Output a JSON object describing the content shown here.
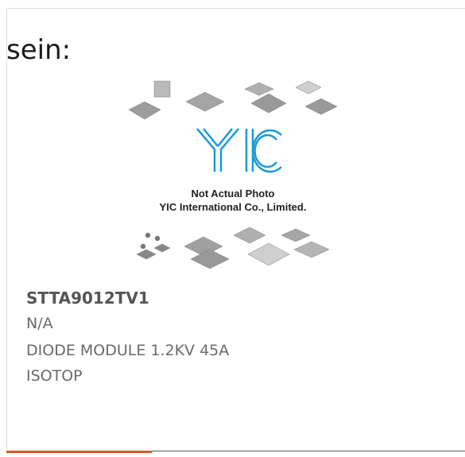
{
  "heading": "sein:",
  "image": {
    "caption_line1": "Not Actual Photo",
    "caption_line2": "YIC International Co., Limited.",
    "logo_text": "YIC",
    "colors": {
      "logo": "#1a9ad6",
      "caption": "#222222",
      "chips": "#9a9a9a"
    }
  },
  "product": {
    "part_number": "STTA9012TV1",
    "manufacturer": "N/A",
    "description": "DIODE MODULE 1.2KV 45A",
    "package": "ISOTOP"
  },
  "accent_color": "#e2541f"
}
